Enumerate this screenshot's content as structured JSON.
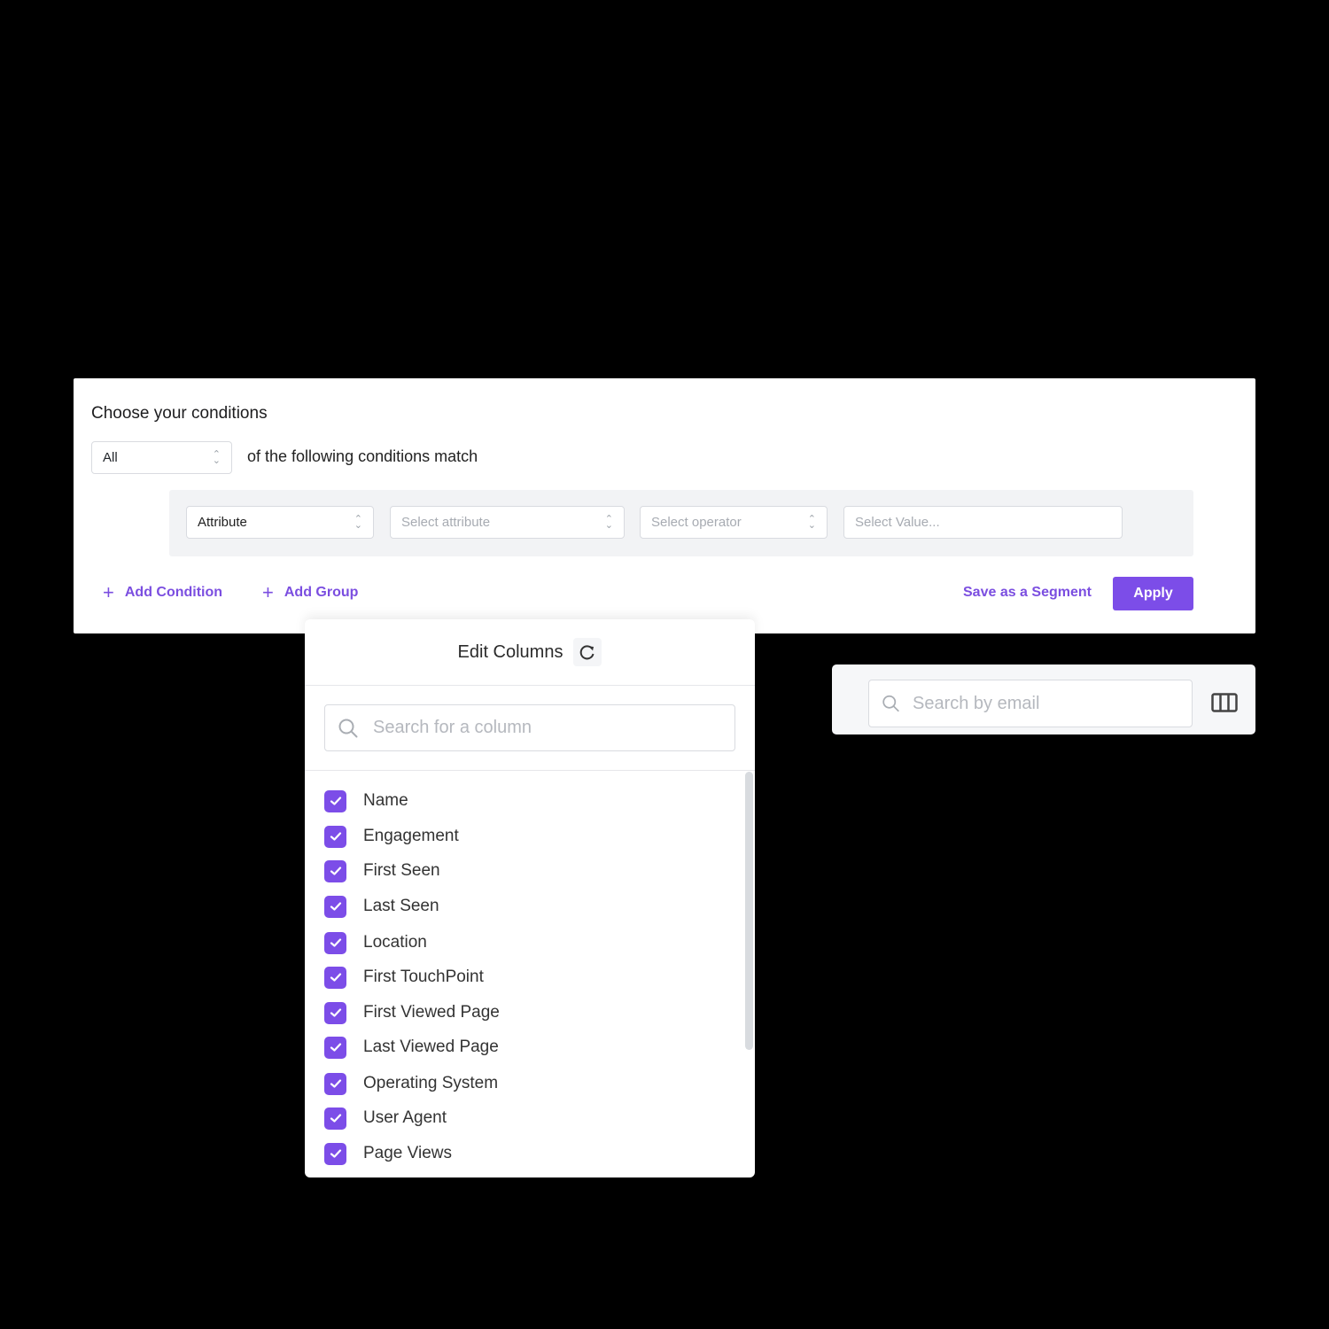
{
  "conditions": {
    "title": "Choose your conditions",
    "match_select": {
      "value": "All"
    },
    "match_text": "of the following conditions match",
    "row": {
      "attribute_type": {
        "value": "Attribute"
      },
      "attribute": {
        "placeholder": "Select attribute"
      },
      "operator": {
        "placeholder": "Select operator"
      },
      "value": {
        "placeholder": "Select Value..."
      }
    },
    "add_condition_label": "Add Condition",
    "add_group_label": "Add Group",
    "save_segment_label": "Save as a Segment",
    "apply_label": "Apply"
  },
  "edit_columns": {
    "title": "Edit Columns",
    "search_placeholder": "Search for a column",
    "items": [
      {
        "label": "Name",
        "checked": true
      },
      {
        "label": "Engagement",
        "checked": true
      },
      {
        "label": "First Seen",
        "checked": true
      },
      {
        "label": "Last Seen",
        "checked": true
      },
      {
        "label": "Location",
        "checked": true
      },
      {
        "label": "First TouchPoint",
        "checked": true
      },
      {
        "label": "First Viewed Page",
        "checked": true
      },
      {
        "label": "Last Viewed Page",
        "checked": true
      },
      {
        "label": "Operating System",
        "checked": true
      },
      {
        "label": "User Agent",
        "checked": true
      },
      {
        "label": "Page Views",
        "checked": true
      }
    ]
  },
  "email_search": {
    "placeholder": "Search by email"
  },
  "colors": {
    "accent": "#7c4de8",
    "link": "#7b4ee0"
  }
}
